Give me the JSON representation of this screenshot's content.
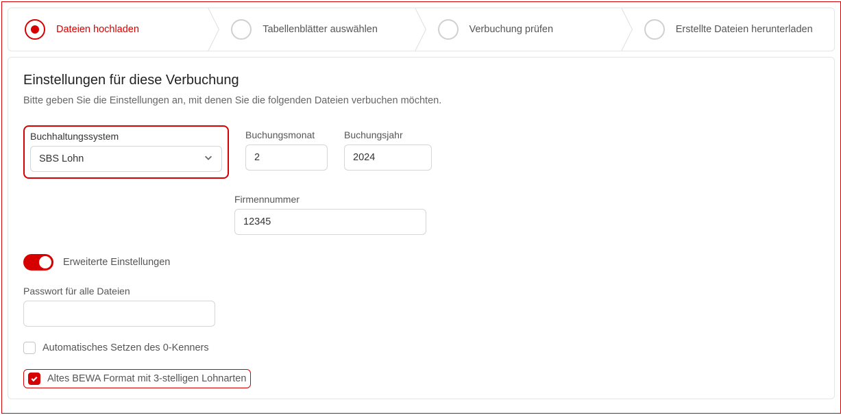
{
  "stepper": {
    "steps": [
      {
        "label": "Dateien hochladen",
        "active": true
      },
      {
        "label": "Tabellenblätter auswählen",
        "active": false
      },
      {
        "label": "Verbuchung prüfen",
        "active": false
      },
      {
        "label": "Erstellte Dateien herunterladen",
        "active": false
      }
    ]
  },
  "panel": {
    "title": "Einstellungen für diese Verbuchung",
    "subtitle": "Bitte geben Sie die Einstellungen an, mit denen Sie die folgenden Dateien verbuchen möchten."
  },
  "fields": {
    "system": {
      "label": "Buchhaltungssystem",
      "value": "SBS Lohn"
    },
    "month": {
      "label": "Buchungsmonat",
      "value": "2"
    },
    "year": {
      "label": "Buchungsjahr",
      "value": "2024"
    },
    "company_no": {
      "label": "Firmennummer",
      "value": "12345"
    },
    "advanced": {
      "label": "Erweiterte Einstellungen",
      "on": true
    },
    "password": {
      "label": "Passwort für alle Dateien",
      "value": ""
    },
    "auto_zero": {
      "label": "Automatisches Setzen des 0-Kenners",
      "checked": false
    },
    "bewa": {
      "label": "Altes BEWA Format mit 3-stelligen Lohnarten",
      "checked": true
    }
  }
}
